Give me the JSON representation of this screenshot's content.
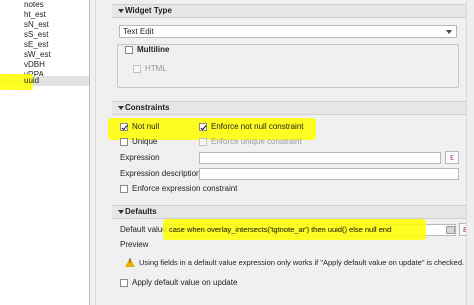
{
  "fields": [
    "notes",
    "ht_est",
    "sN_est",
    "sS_est",
    "sE_est",
    "sW_est",
    "vDBH",
    "vRPA",
    "uuid"
  ],
  "widget_type": {
    "title": "Widget Type",
    "selected": "Text Edit",
    "multiline_label": "Multiline",
    "html_label": "HTML"
  },
  "constraints": {
    "title": "Constraints",
    "not_null": "Not null",
    "enforce_not_null": "Enforce not null constraint",
    "unique": "Unique",
    "enforce_unique": "Enforce unique constraint",
    "expression_label": "Expression",
    "expression_value": "",
    "description_label": "Expression description",
    "description_value": "",
    "enforce_expression": "Enforce expression constraint"
  },
  "defaults": {
    "title": "Defaults",
    "default_value_label": "Default value",
    "default_value": "case  when overlay_intersects('tgtnote_ar') then uuid()  else null  end",
    "preview_label": "Preview",
    "warning": "Using fields in a default value expression only works if \"Apply default value on update\" is checked.",
    "apply_on_update": "Apply default value on update"
  },
  "colors": {
    "highlight": "#ffff00",
    "expression_button": "#b5308c",
    "warning": "#e8b100"
  }
}
